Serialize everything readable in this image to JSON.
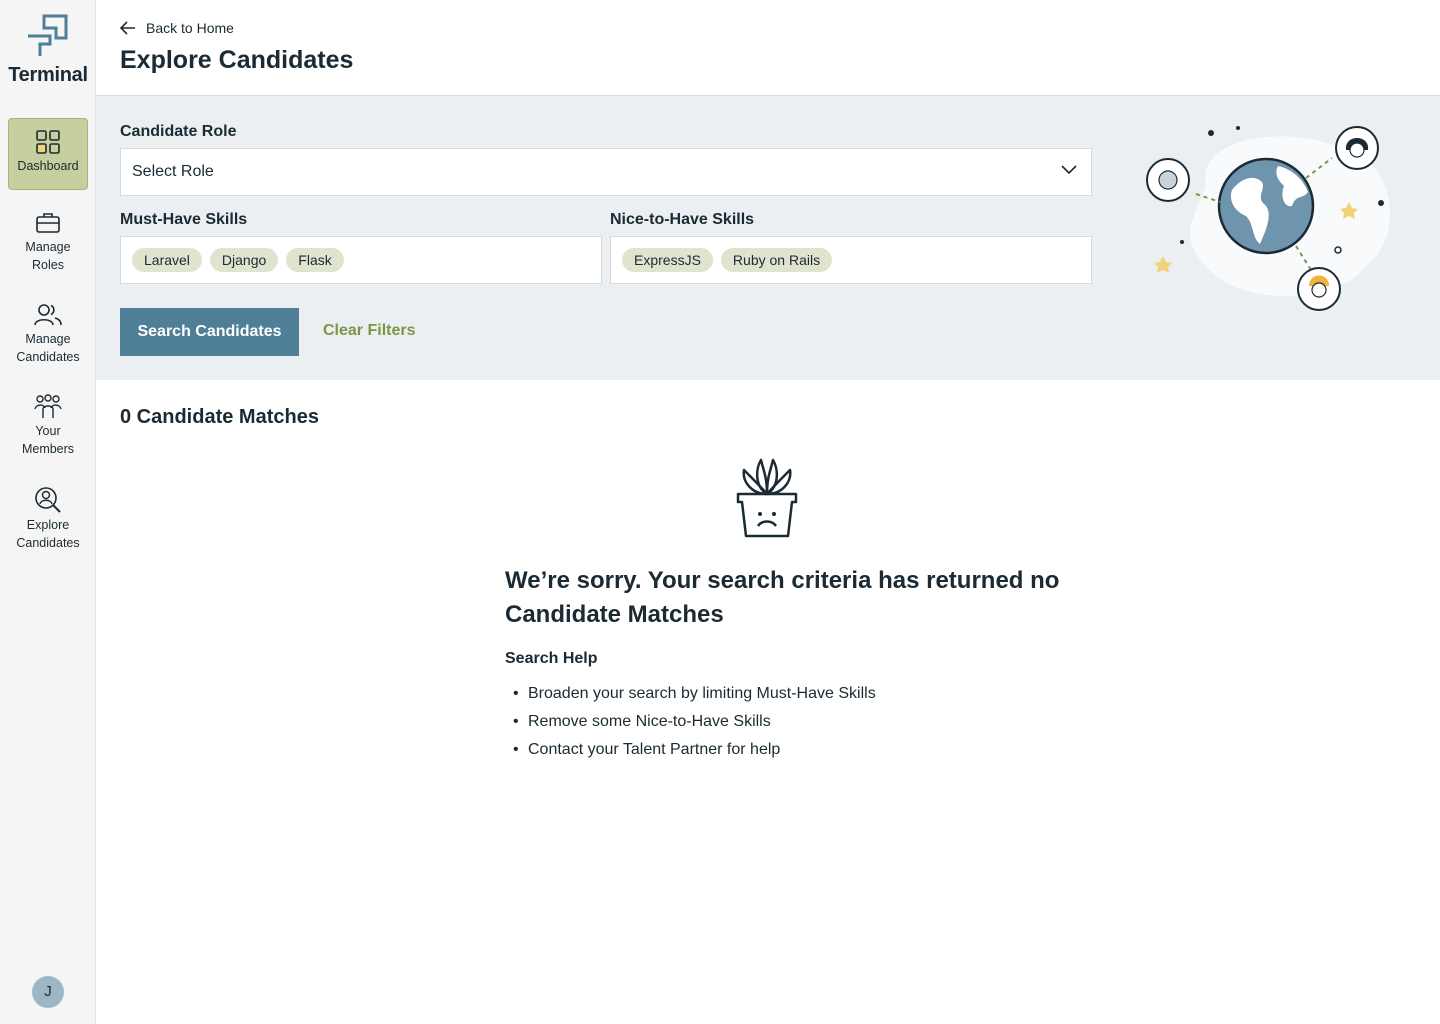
{
  "brand": {
    "name": "Terminal"
  },
  "sidebar": {
    "items": [
      {
        "label": "Dashboard",
        "icon": "grid-icon"
      },
      {
        "label": "Manage Roles",
        "icon": "briefcase-icon"
      },
      {
        "label": "Manage Candidates",
        "icon": "users-icon"
      },
      {
        "label": "Your Members",
        "icon": "team-icon"
      },
      {
        "label": "Explore Candidates",
        "icon": "search-person-icon"
      }
    ],
    "active": "Dashboard",
    "avatar_initial": "J"
  },
  "header": {
    "back_label": "Back to Home",
    "title": "Explore Candidates"
  },
  "filters": {
    "role_label": "Candidate Role",
    "role_value": "Select Role",
    "must_have_label": "Must-Have Skills",
    "must_have_tags": [
      "Laravel",
      "Django",
      "Flask"
    ],
    "nice_to_have_label": "Nice-to-Have Skills",
    "nice_to_have_tags": [
      "ExpressJS",
      "Ruby on Rails"
    ],
    "search_button": "Search Candidates",
    "clear_button": "Clear Filters"
  },
  "results": {
    "matches_label": "0 Candidate Matches",
    "empty_title": "We’re sorry. Your search criteria has returned no Candidate Matches",
    "help_title": "Search Help",
    "help_items": [
      "Broaden your search by limiting Must-Have Skills",
      "Remove some Nice-to-Have Skills",
      "Contact your Talent Partner for help"
    ]
  },
  "colors": {
    "primary": "#4f7e97",
    "accent_green": "#7c9744",
    "tag_bg": "#e0e4cf",
    "active_nav_bg": "#c6cf9f",
    "filter_panel_bg": "#ebeff2",
    "text": "#1b2a33"
  }
}
